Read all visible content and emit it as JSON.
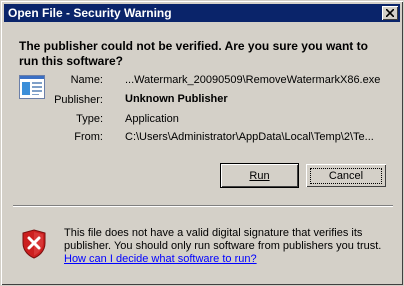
{
  "window": {
    "title": "Open File - Security Warning",
    "close_glyph": "✕"
  },
  "headline": "The publisher could not be verified.  Are you sure you want to run this software?",
  "details": {
    "name_label": "Name:",
    "name_value": "...Watermark_20090509\\RemoveWatermarkX86.exe",
    "publisher_label": "Publisher:",
    "publisher_value": "Unknown Publisher",
    "type_label": "Type:",
    "type_value": "Application",
    "from_label": "From:",
    "from_value": "C:\\Users\\Administrator\\AppData\\Local\\Temp\\2\\Te..."
  },
  "buttons": {
    "run_label": "Run",
    "cancel_label": "Cancel"
  },
  "warning": {
    "text": "This file does not have a valid digital signature that verifies its publisher.  You should only run software from publishers you trust.",
    "link": "How can I decide what software to run?"
  },
  "icons": {
    "application": "application-window-icon",
    "warning": "security-shield-x-icon",
    "close": "close-icon"
  },
  "colors": {
    "titlebar": "#0a246a",
    "face": "#d4d0c8",
    "link": "#0000ff",
    "shield_red": "#cc1f1f"
  }
}
